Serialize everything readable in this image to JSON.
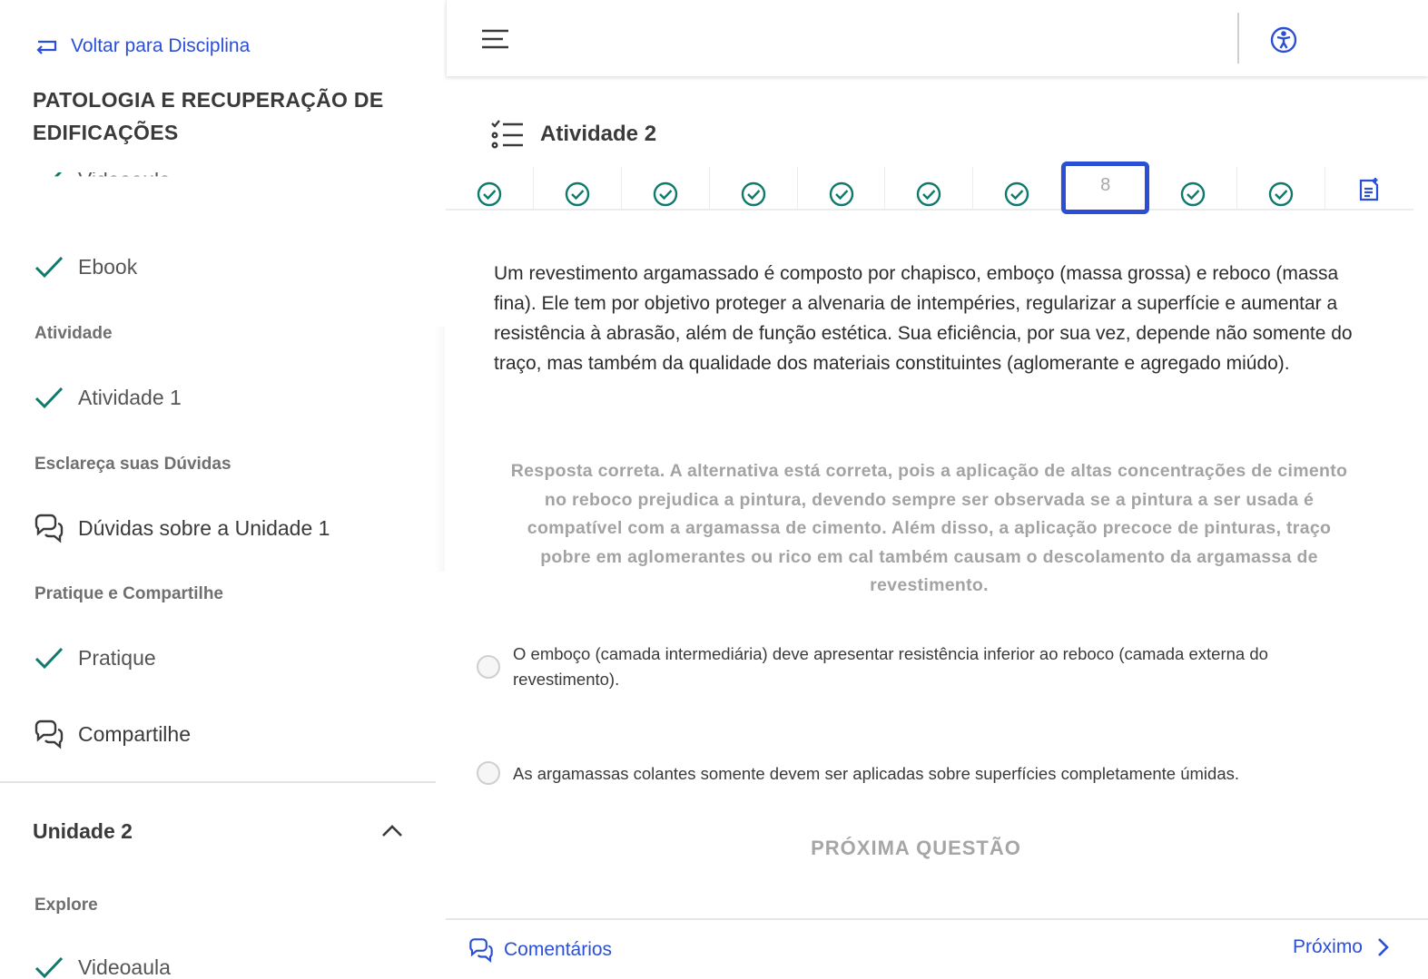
{
  "sidebar": {
    "back_label": "Voltar para Disciplina",
    "course_title": "PATOLOGIA E RECUPERAÇÃO DE EDIFICAÇÕES",
    "partial_item_label": "Videoaula",
    "ebook_label": "Ebook",
    "section_atividade": "Atividade",
    "atividade1_label": "Atividade 1",
    "section_duvidas": "Esclareça suas Dúvidas",
    "duvidas_label": "Dúvidas sobre a Unidade 1",
    "section_pratique": "Pratique e Compartilhe",
    "pratique_label": "Pratique",
    "compartilhe_label": "Compartilhe",
    "unit2_label": "Unidade 2",
    "section_explore": "Explore",
    "videoaula_label": "Videoaula"
  },
  "main": {
    "activity_title": "Atividade 2",
    "current_question": "8",
    "question_text": "Um revestimento argamassado é composto por chapisco, emboço (massa grossa) e reboco (massa fina). Ele tem por objetivo proteger a alvenaria de intempéries, regularizar a superfície e aumentar a resistência à abrasão, além de função estética. Sua eficiência, por sua vez, depende não somente do traço, mas também da qualidade dos materiais constituintes (aglomerante e agregado miúdo).",
    "feedback_text": "Resposta correta. A alternativa está correta, pois a aplicação de altas concentrações de cimento no reboco prejudica a pintura, devendo sempre ser observada se a pintura a ser usada é compatível com a argamassa de cimento. Além disso, a aplicação precoce de pinturas, traço pobre em aglomerantes ou rico em cal também causam o descolamento da argamassa de revestimento.",
    "option_1": "O emboço (camada intermediária) deve apresentar resistência inferior ao reboco (camada externa do revestimento).",
    "option_2": "As argamassas colantes somente devem ser aplicadas sobre superfícies completamente úmidas.",
    "next_question_label": "PRÓXIMA QUESTÃO",
    "comments_label": "Comentários",
    "next_label": "Próximo"
  },
  "colors": {
    "accent_blue": "#2b4fd4",
    "check_green": "#0f7a6c",
    "muted_text": "#a3a3a3"
  },
  "icons": {
    "back": "return-arrow-icon",
    "check": "check-icon",
    "chat": "chat-icon",
    "chevron": "chevron-up-icon",
    "menu": "hamburger-menu-icon",
    "accessibility": "accessibility-icon",
    "list": "checklist-icon",
    "answered": "check-circle-icon",
    "summary": "document-edit-icon",
    "next": "chevron-right-icon"
  }
}
